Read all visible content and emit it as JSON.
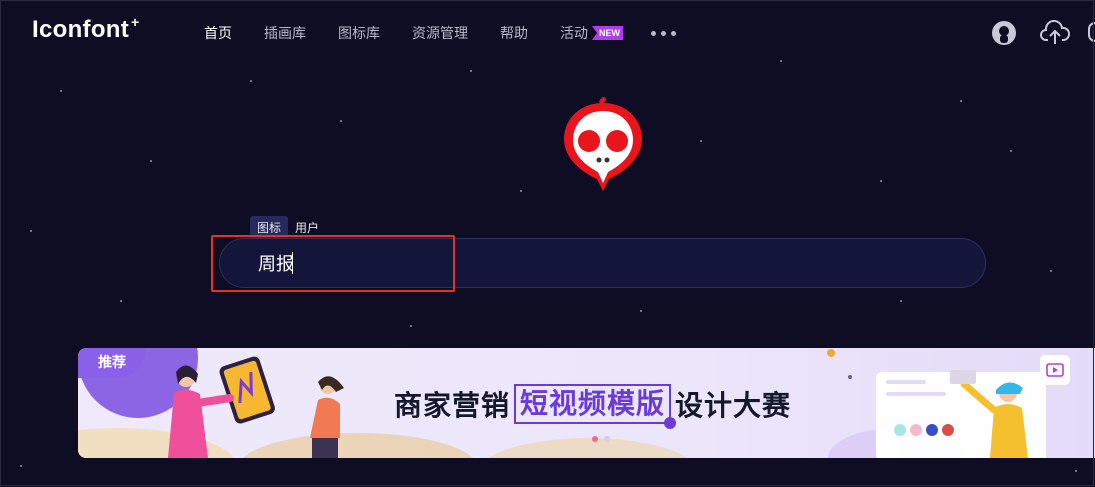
{
  "brand": {
    "name": "Iconfont",
    "plus": "+"
  },
  "nav": {
    "items": [
      {
        "label": "首页",
        "active": true
      },
      {
        "label": "插画库",
        "active": false
      },
      {
        "label": "图标库",
        "active": false
      },
      {
        "label": "资源管理",
        "active": false
      },
      {
        "label": "帮助",
        "active": false
      }
    ],
    "activity": {
      "label": "活动",
      "badge": "NEW"
    },
    "more_icon": "more-dots-icon"
  },
  "header_icons": [
    "user-avatar-icon",
    "upload-cloud-icon"
  ],
  "search": {
    "tabs": [
      {
        "label": "图标",
        "active": true
      },
      {
        "label": "用户",
        "active": false
      }
    ],
    "value": "周报",
    "placeholder": ""
  },
  "banner": {
    "badge": "推荐",
    "title_prefix": "商家营销",
    "title_highlight": "短视频模版",
    "title_suffix": "设计大赛",
    "slide_index": 1,
    "slide_count": 2
  },
  "colors": {
    "background": "#0f0d23",
    "accent": "#6a3bd8",
    "new_badge": "#b03cf0",
    "highlight_box": "#e8311e",
    "mascot_red": "#e8151d"
  }
}
